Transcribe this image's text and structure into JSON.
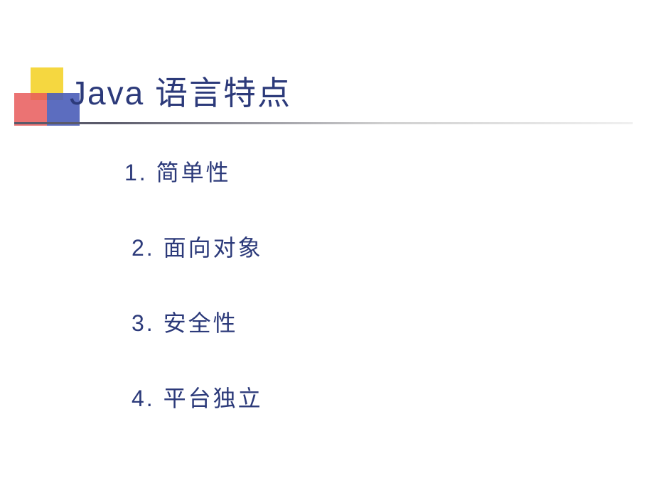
{
  "slide": {
    "title": "Java 语言特点",
    "items": [
      {
        "number": "1.",
        "text": "简单性"
      },
      {
        "number": "2.",
        "text": "面向对象"
      },
      {
        "number": "3.",
        "text": "安全性"
      },
      {
        "number": "4.",
        "text": "平台独立"
      }
    ]
  }
}
